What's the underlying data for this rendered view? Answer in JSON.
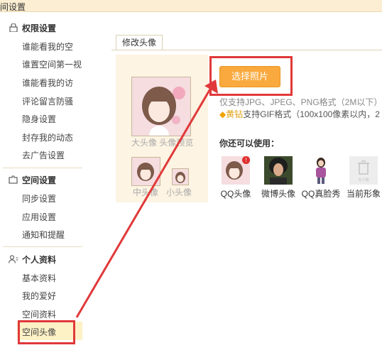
{
  "window": {
    "title": "间设置"
  },
  "sidebar": {
    "sections": [
      {
        "title": "权限设置",
        "icon": "lock-icon"
      },
      {
        "title": "空间设置",
        "icon": "puzzle-icon"
      },
      {
        "title": "个人资料",
        "icon": "person-icon"
      }
    ],
    "permission_items": [
      "谁能看我的空",
      "谁置空间第一视",
      "谁能看我的访",
      "评论留言防骚",
      "隐身设置",
      "封存我的动态",
      "去广告设置"
    ],
    "space_items": [
      "同步设置",
      "应用设置",
      "通知和提醒"
    ],
    "profile_items": [
      "基本资料",
      "我的爱好",
      "空间资料",
      "空间头像"
    ]
  },
  "main": {
    "tab_label": "修改头像",
    "preview": {
      "big_label": "大头像 头像预览",
      "mid_label": "中头像",
      "small_label": "小头像"
    },
    "choose_button": "选择照片",
    "note_formats": "仅支持JPG、JPEG、PNG格式（2M以下）",
    "note_vip_tag": "黄钻",
    "note_gif": "支持GIF格式（100x100像素以内，2",
    "you_can_use": "你还可以使用：",
    "options": [
      {
        "label": "QQ头像",
        "badge": "!"
      },
      {
        "label": "微博头像"
      },
      {
        "label": "QQ真脸秀"
      },
      {
        "label": "当前形象",
        "inner": "无人物"
      }
    ]
  },
  "colors": {
    "accent_orange": "#f9a93d",
    "highlight_red": "#e0393a",
    "topbar": "#fbeed2",
    "active_item": "#fdf1c6"
  }
}
